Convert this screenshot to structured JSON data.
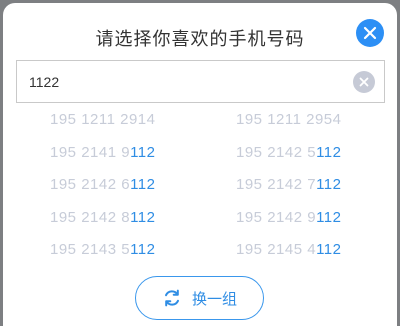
{
  "dialog": {
    "title": "请选择你喜欢的手机号码"
  },
  "search": {
    "value": "1122"
  },
  "numbers": [
    [
      {
        "pre": "195 1211 2914",
        "hl": ""
      },
      {
        "pre": "195 1211 2954",
        "hl": ""
      }
    ],
    [
      {
        "pre": "195 2141 9",
        "hl": "112"
      },
      {
        "pre": "195 2142 5",
        "hl": "112"
      }
    ],
    [
      {
        "pre": "195 2142 6",
        "hl": "112"
      },
      {
        "pre": "195 2142 7",
        "hl": "112"
      }
    ],
    [
      {
        "pre": "195 2142 8",
        "hl": "112"
      },
      {
        "pre": "195 2142 9",
        "hl": "112"
      }
    ],
    [
      {
        "pre": "195 2143 5",
        "hl": "112"
      },
      {
        "pre": "195 2145 4",
        "hl": "112"
      }
    ]
  ],
  "refresh": {
    "label": "换一组"
  },
  "colors": {
    "accent": "#2f8de4",
    "muted_number": "#c7ccd8",
    "clear_icon": "#c6cad6"
  },
  "icons": {
    "close": "close-icon",
    "clear": "clear-icon",
    "refresh": "refresh-icon"
  }
}
